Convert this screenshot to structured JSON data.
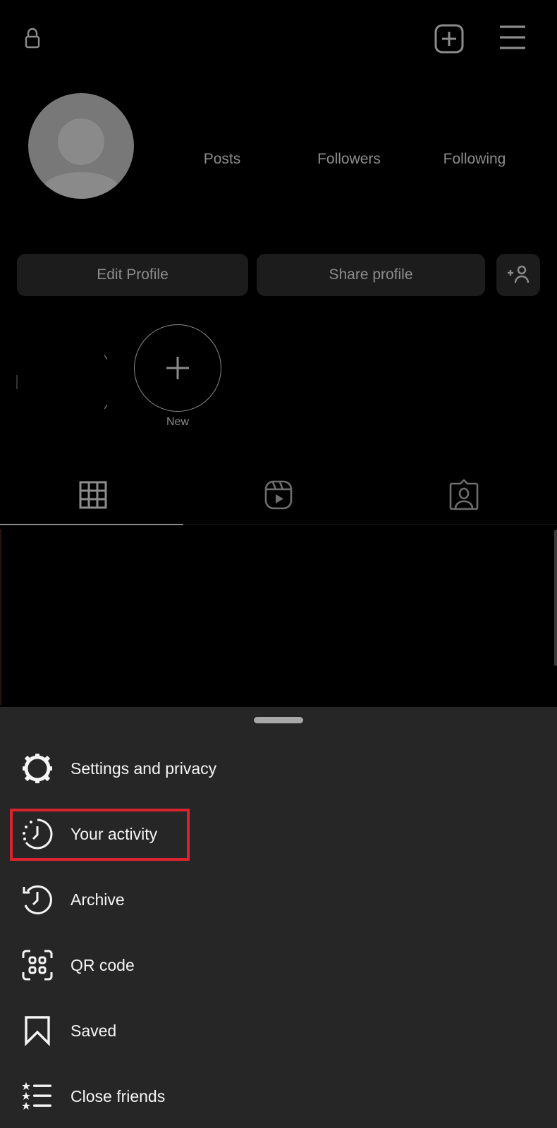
{
  "header": {
    "icons": [
      "lock-icon",
      "create-post-icon",
      "menu-icon"
    ]
  },
  "profile": {
    "stats": [
      {
        "label": "Posts"
      },
      {
        "label": "Followers"
      },
      {
        "label": "Following"
      }
    ],
    "buttons": {
      "edit": "Edit Profile",
      "share": "Share profile",
      "add_person_icon": "add-person-icon"
    }
  },
  "highlights": {
    "new_label": "New"
  },
  "tabs": [
    {
      "name": "posts-grid",
      "icon": "grid-icon",
      "active": true
    },
    {
      "name": "reels",
      "icon": "reels-icon",
      "active": false
    },
    {
      "name": "tagged",
      "icon": "tagged-icon",
      "active": false
    }
  ],
  "sheet": {
    "items": [
      {
        "label": "Settings and privacy",
        "icon": "gear-icon"
      },
      {
        "label": "Your activity",
        "icon": "activity-clock-icon",
        "highlighted": true
      },
      {
        "label": "Archive",
        "icon": "archive-history-icon"
      },
      {
        "label": "QR code",
        "icon": "qr-code-icon"
      },
      {
        "label": "Saved",
        "icon": "bookmark-icon"
      },
      {
        "label": "Close friends",
        "icon": "close-friends-list-icon"
      }
    ]
  },
  "colors": {
    "background": "#000000",
    "sheet": "#262626",
    "button": "#1c1c1c",
    "muted_text": "#8c8c8c",
    "sheet_text": "#f5f5f5",
    "highlight_box": "#d9232e"
  }
}
